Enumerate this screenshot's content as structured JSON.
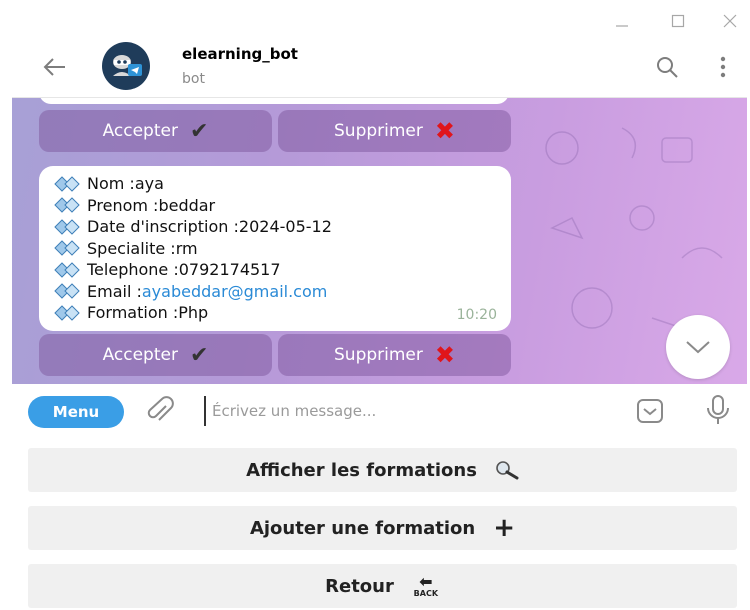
{
  "window": {
    "minimize_icon": "minimize-icon",
    "maximize_icon": "maximize-icon",
    "close_icon": "close-icon"
  },
  "header": {
    "bot_name": "elearning_bot",
    "bot_subtitle": "bot",
    "back_icon": "arrow-left-icon",
    "search_icon": "search-icon",
    "more_icon": "more-vertical-icon"
  },
  "chat": {
    "keyboard_top": {
      "accept_label": "Accepter",
      "accept_icon": "✔",
      "delete_label": "Supprimer",
      "delete_icon": "✖"
    },
    "message": {
      "lines": [
        {
          "label": "Nom : ",
          "value": "aya"
        },
        {
          "label": "Prenom : ",
          "value": "beddar"
        },
        {
          "label": "Date d'inscription : ",
          "value": "2024-05-12"
        },
        {
          "label": "Specialite : ",
          "value": "rm"
        },
        {
          "label": "Telephone : ",
          "value": "0792174517"
        },
        {
          "label": "Email : ",
          "value": "ayabeddar@gmail.com"
        },
        {
          "label": "Formation : ",
          "value": "Php"
        }
      ],
      "time": "10:20"
    },
    "keyboard_bottom": {
      "accept_label": "Accepter",
      "accept_icon": "✔",
      "delete_label": "Supprimer",
      "delete_icon": "✖"
    }
  },
  "input": {
    "menu_label": "Menu",
    "placeholder": "Écrivez un message...",
    "value": ""
  },
  "reply_keyboard": {
    "show_formations": "Afficher les formations",
    "add_formation": "Ajouter une formation",
    "back": "Retour",
    "back_icon_text": "BACK"
  },
  "colors": {
    "accent": "#3a9ee6",
    "delete_red": "#e0151b",
    "email_link": "#2a8ad6"
  }
}
